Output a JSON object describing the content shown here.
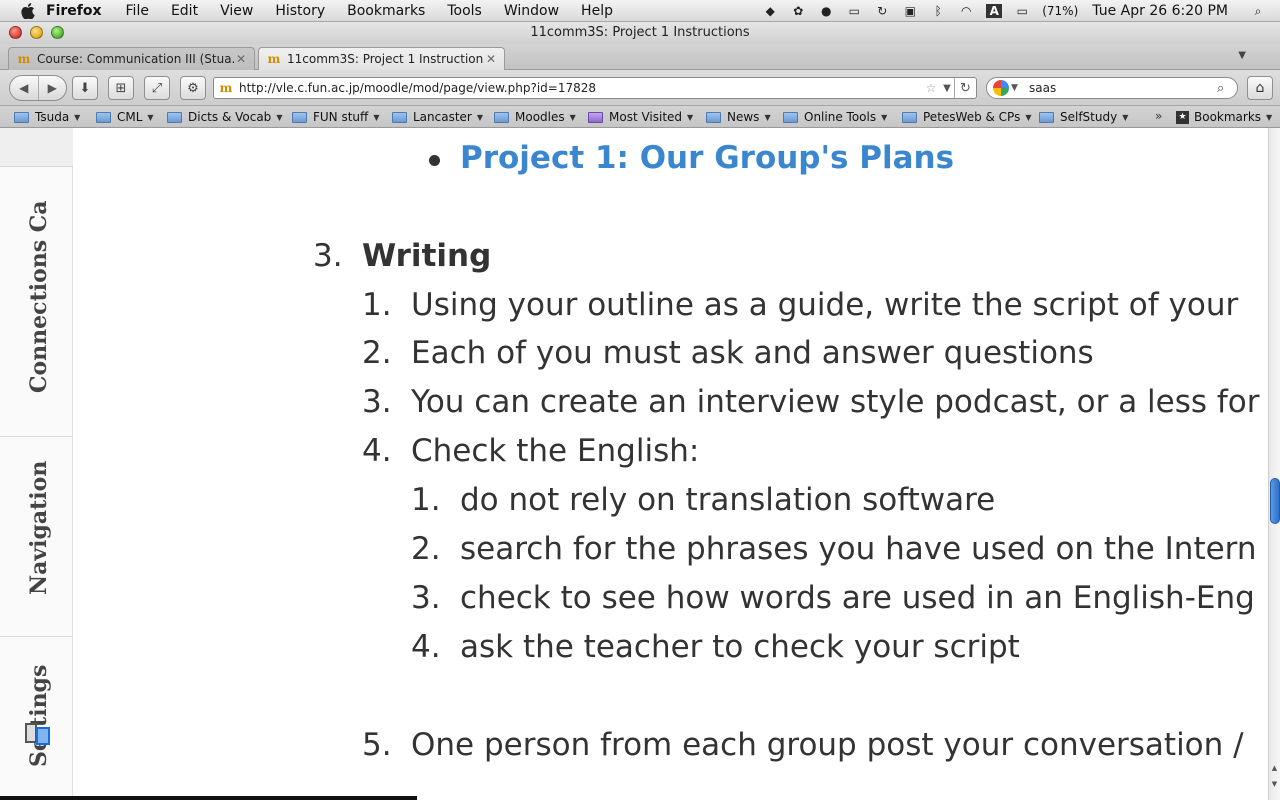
{
  "menubar": {
    "app": "Firefox",
    "items": [
      "File",
      "Edit",
      "View",
      "History",
      "Bookmarks",
      "Tools",
      "Window",
      "Help"
    ],
    "battery": "(71%)",
    "clock": "Tue Apr 26  6:20 PM"
  },
  "window": {
    "title": "11comm3S: Project 1 Instructions"
  },
  "tabs": [
    {
      "label": "Course: Communication III (Stua...",
      "active": false
    },
    {
      "label": "11comm3S: Project 1 Instructions",
      "active": true
    }
  ],
  "nav": {
    "url": "http://vle.c.fun.ac.jp/moodle/mod/page/view.php?id=17828",
    "search_value": "saas"
  },
  "bookmarks": [
    {
      "label": "Tsuda",
      "menu": true
    },
    {
      "label": "CML",
      "menu": true
    },
    {
      "label": "Dicts & Vocab",
      "menu": true
    },
    {
      "label": "FUN stuff",
      "menu": true
    },
    {
      "label": "Lancaster",
      "menu": true
    },
    {
      "label": "Moodles",
      "menu": true
    },
    {
      "label": "Most Visited",
      "menu": true
    },
    {
      "label": "News",
      "menu": true
    },
    {
      "label": "Online Tools",
      "menu": true
    },
    {
      "label": "PetesWeb & CPs",
      "menu": true
    },
    {
      "label": "SelfStudy",
      "menu": true
    },
    {
      "label": "Bookmarks",
      "menu": true
    }
  ],
  "dock": {
    "tabs": [
      "Connections Ca",
      "Navigation",
      "Settings"
    ]
  },
  "page": {
    "link_item": "Project 1: Our Group's Plans",
    "section_number": "3.",
    "section_title": "Writing",
    "items": [
      {
        "n": "1.",
        "text": "Using your outline as a guide, write the script of your"
      },
      {
        "n": "2.",
        "text": "Each of you must ask and answer questions"
      },
      {
        "n": "3.",
        "text": "You can create an interview style podcast, or a less for"
      },
      {
        "n": "4.",
        "text": "Check the English:"
      }
    ],
    "subitems": [
      {
        "n": "1.",
        "text": "do not rely on translation software"
      },
      {
        "n": "2.",
        "text": "search for the phrases you have used on the Intern"
      },
      {
        "n": "3.",
        "text": "check to see how words are used in an English-Eng"
      },
      {
        "n": "4.",
        "text": "ask the teacher to check your script"
      }
    ],
    "item5": {
      "n": "5.",
      "text": "One person from each group post your conversation /"
    }
  }
}
